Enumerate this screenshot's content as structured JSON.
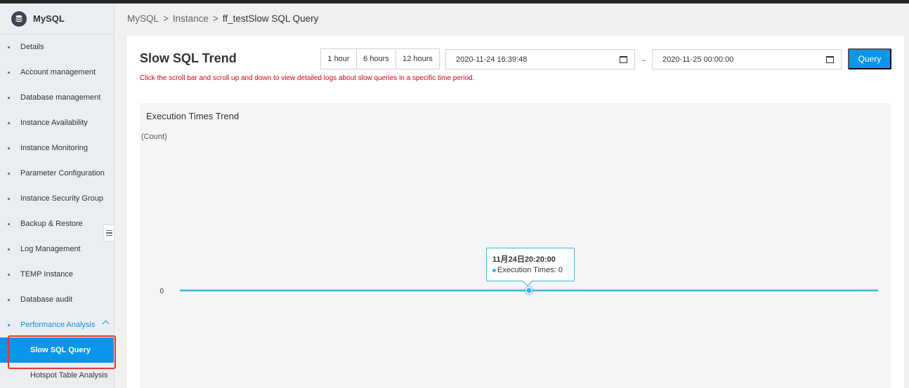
{
  "sidebar": {
    "brand": "MySQL",
    "items": [
      {
        "label": "Details"
      },
      {
        "label": "Account management"
      },
      {
        "label": "Database management"
      },
      {
        "label": "Instance Availability"
      },
      {
        "label": "Instance Monitoring"
      },
      {
        "label": "Parameter Configuration"
      },
      {
        "label": "Instance Security Group"
      },
      {
        "label": "Backup & Restore"
      },
      {
        "label": "Log Management"
      },
      {
        "label": "TEMP Instance"
      },
      {
        "label": "Database audit"
      },
      {
        "label": "Performance Analysis"
      }
    ],
    "sub_items": [
      {
        "label": "Slow SQL Query"
      },
      {
        "label": "Hotspot Table Analysis"
      }
    ]
  },
  "breadcrumb": {
    "root": "MySQL",
    "sep": ">",
    "instance": "Instance",
    "current": "ff_testSlow SQL Query"
  },
  "main": {
    "title": "Slow SQL Trend",
    "hint": "Click the scroll bar and scroll up and down to view detailed logs about slow queries in a specific time period.",
    "range_buttons": [
      "1 hour",
      "6 hours",
      "12 hours"
    ],
    "start_date": "2020-11-24 16:39:48",
    "tilde": "~",
    "end_date": "2020-11-25 00:00:00",
    "query_label": "Query"
  },
  "chart_data": {
    "type": "line",
    "title": "Execution Times Trend",
    "ylabel": "(Count)",
    "y_ticks": [
      "0"
    ],
    "series": [
      {
        "name": "Execution Times",
        "values": [
          0,
          0,
          0
        ]
      }
    ],
    "tooltip": {
      "time": "11月24日20:20:00",
      "label": "Execution Times: 0"
    },
    "color": "#3fb1e3"
  }
}
